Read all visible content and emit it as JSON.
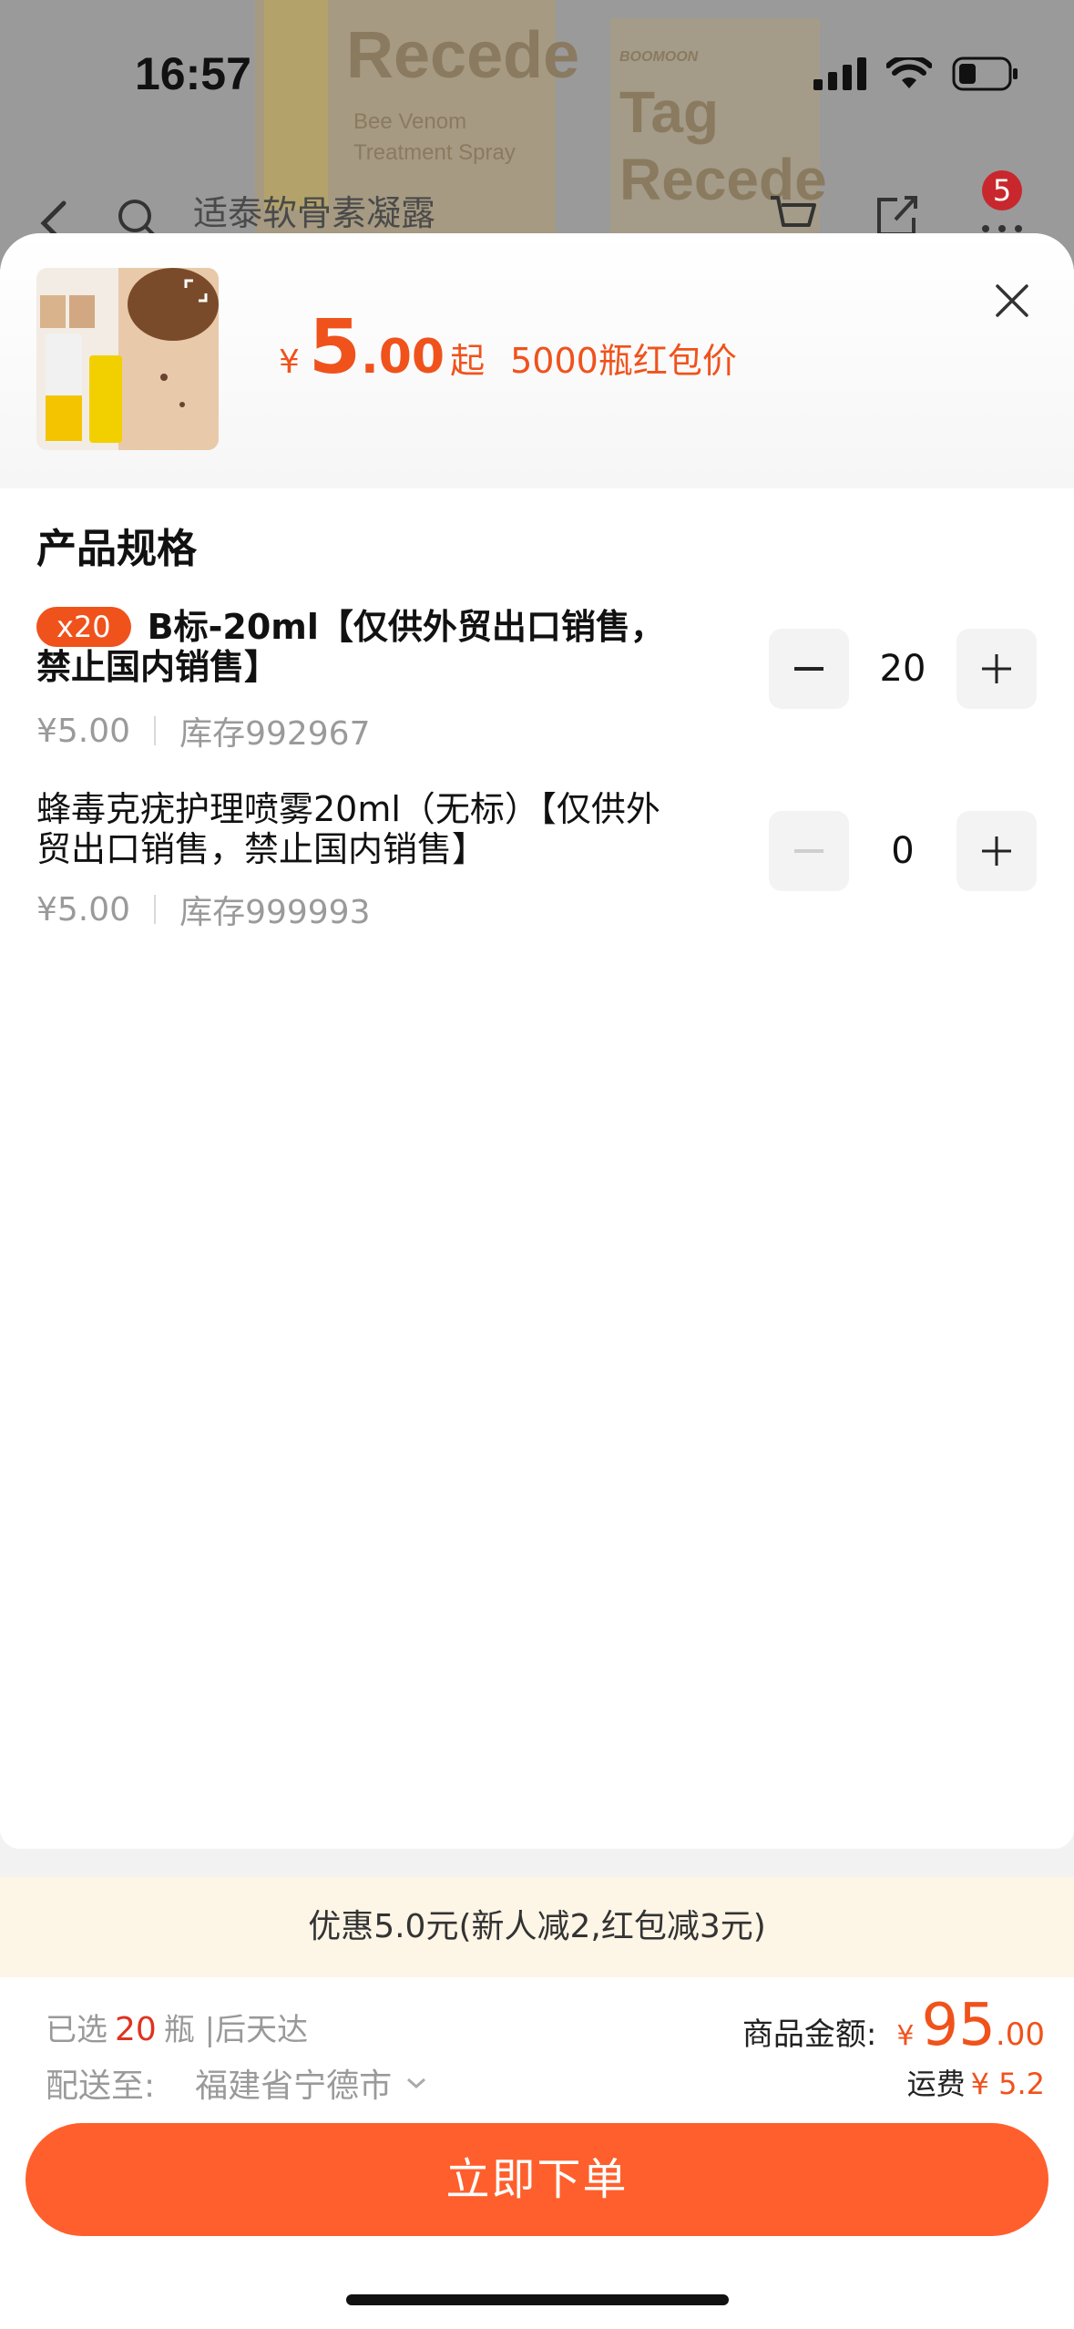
{
  "status_bar": {
    "time": "16:57"
  },
  "background_page": {
    "search_text": "适泰软骨素凝露",
    "cart_badge": "5",
    "art_words": [
      "Tag",
      "Recede",
      "Bee Venom",
      "Treatment Spray",
      "BOOMOON"
    ]
  },
  "sheet": {
    "price": {
      "symbol": "¥",
      "integer": "5",
      "decimal": ".00",
      "suffix": "起",
      "note": "5000瓶红包价"
    },
    "section_title": "产品规格",
    "specs": [
      {
        "badge": "x20",
        "name": "B标-20ml【仅供外贸出口销售，禁止国内销售】",
        "price": "¥5.00",
        "stock": "库存992967",
        "qty": "20"
      },
      {
        "badge": "",
        "name": "蜂毒克疣护理喷雾20ml（无标）【仅供外贸出口销售，禁止国内销售】",
        "price": "¥5.00",
        "stock": "库存999993",
        "qty": "0"
      }
    ]
  },
  "promo": {
    "text": "优惠5.0元(新人减2,红包减3元)"
  },
  "bottom": {
    "selected_prefix": "已选",
    "selected_count": "20",
    "selected_suffix": "瓶 |后天达",
    "dest_label": "配送至:",
    "dest_city": "福建省宁德市",
    "amount_label": "商品金额:",
    "amount_symbol": "¥",
    "amount_int": "95",
    "amount_dec": ".00",
    "shipping_label": "运费",
    "shipping_value": "¥ 5.2",
    "order_button": "立即下单"
  },
  "colors": {
    "accent": "#f0521c",
    "button": "#ff5f2c",
    "promo_bg": "#fdf5e6"
  }
}
